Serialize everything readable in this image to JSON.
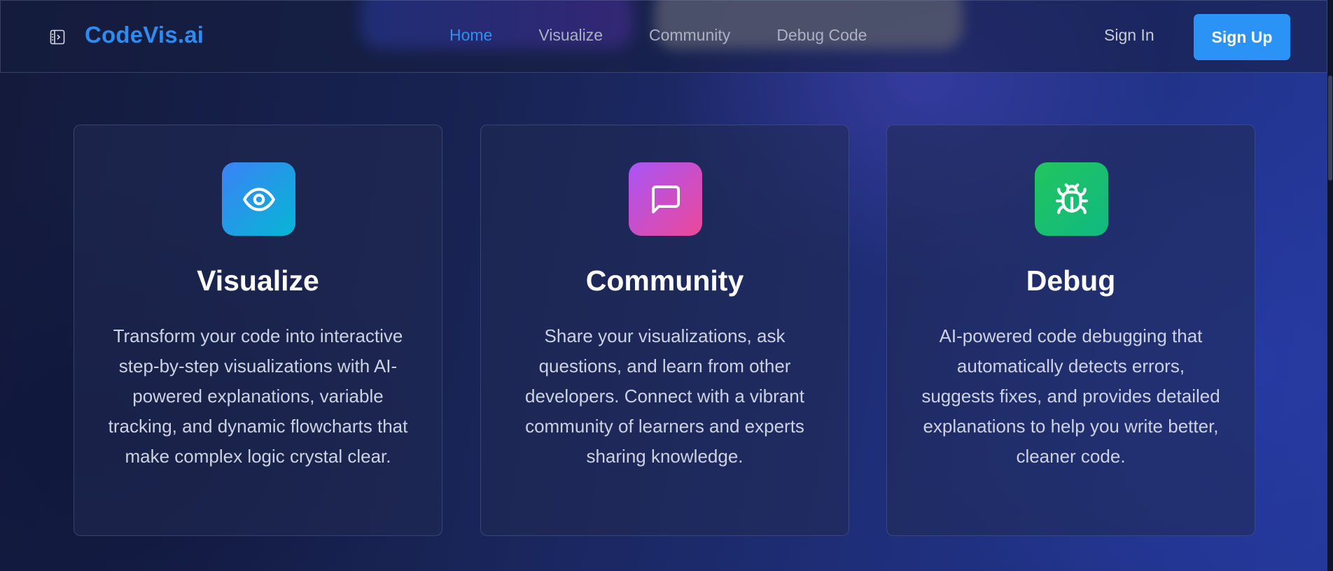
{
  "brand": {
    "name": "CodeVis.ai",
    "color": "#2e8cf0"
  },
  "nav": {
    "links": [
      {
        "label": "Home",
        "active": true
      },
      {
        "label": "Visualize",
        "active": false
      },
      {
        "label": "Community",
        "active": false
      },
      {
        "label": "Debug Code",
        "active": false
      }
    ],
    "sign_in": "Sign In",
    "sign_up": "Sign Up"
  },
  "features": [
    {
      "icon": "eye-icon",
      "icon_gradient": [
        "#3b82f6",
        "#06b6d4"
      ],
      "title": "Visualize",
      "description": "Transform your code into interactive step-by-step visualizations with AI-powered explanations, variable tracking, and dynamic flowcharts that make complex logic crystal clear."
    },
    {
      "icon": "message-square-icon",
      "icon_gradient": [
        "#a855f7",
        "#ec4899"
      ],
      "title": "Community",
      "description": "Share your visualizations, ask questions, and learn from other developers. Connect with a vibrant community of learners and experts sharing knowledge."
    },
    {
      "icon": "bug-icon",
      "icon_gradient": [
        "#22c55e",
        "#10b981"
      ],
      "title": "Debug",
      "description": "AI-powered code debugging that automatically detects errors, suggests fixes, and provides detailed explanations to help you write better, cleaner code."
    }
  ]
}
